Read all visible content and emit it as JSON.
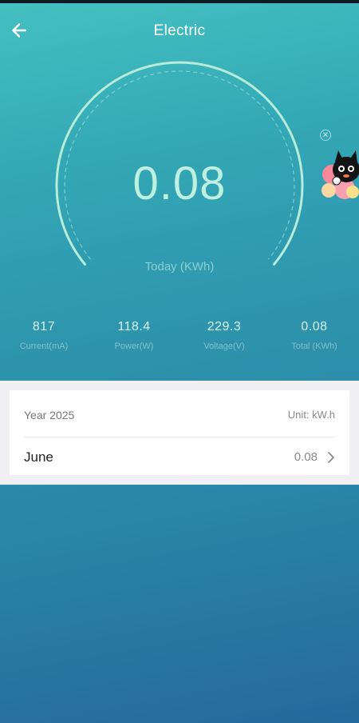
{
  "header": {
    "title": "Electric",
    "back_icon": "arrow-left-icon"
  },
  "gauge": {
    "value": "0.08",
    "unit_label": "Today (KWh)"
  },
  "stats": [
    {
      "value": "817",
      "label": "Current(mA)"
    },
    {
      "value": "118.4",
      "label": "Power(W)"
    },
    {
      "value": "229.3",
      "label": "Voltage(V)"
    },
    {
      "value": "0.08",
      "label": "Total (KWh)"
    }
  ],
  "history": {
    "year_label": "Year 2025",
    "unit_label": "Unit: kW.h",
    "months": [
      {
        "name": "June",
        "value": "0.08"
      }
    ]
  },
  "mascot": {
    "icon": "black-cat-mascot-icon",
    "close_icon": "close-circle-icon"
  },
  "colors": {
    "gradient_top": "#45c1c1",
    "gradient_bottom": "#246a9c",
    "gauge_arc": "#b7ecd9",
    "gauge_value": "#bff0df",
    "panel_bg": "#f0f0f2",
    "card_bg": "#ffffff"
  }
}
